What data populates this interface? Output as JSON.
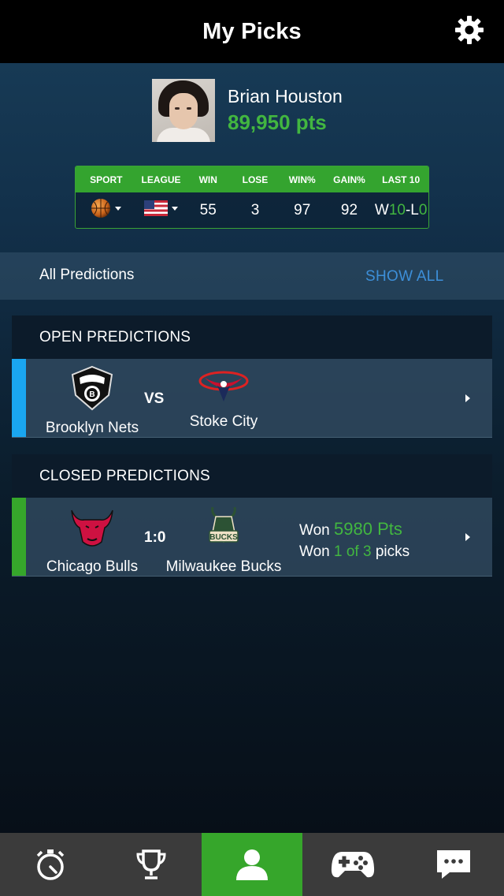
{
  "header": {
    "title": "My Picks",
    "settings_icon": "gear-icon"
  },
  "profile": {
    "name": "Brian Houston",
    "points": "89,950 pts"
  },
  "stats": {
    "headers": [
      "SPORT",
      "LEAGUE",
      "WIN",
      "LOSE",
      "WIN%",
      "GAIN%",
      "LAST 10"
    ],
    "sport_icon": "basketball-icon",
    "league_icon": "us-flag-icon",
    "win": "55",
    "lose": "3",
    "win_pct": "97",
    "gain_pct": "92",
    "last10": {
      "w_label": "W",
      "w_value": "10",
      "separator": "-L",
      "l_value": "0"
    }
  },
  "all_predictions": {
    "label": "All Predictions",
    "action": "SHOW ALL"
  },
  "open_predictions": {
    "title": "OPEN PREDICTIONS",
    "items": [
      {
        "home": "Brooklyn Nets",
        "away": "Stoke City",
        "separator": "VS",
        "accent": "#1aa6f0"
      }
    ]
  },
  "closed_predictions": {
    "title": "CLOSED PREDICTIONS",
    "items": [
      {
        "home": "Chicago Bulls",
        "away": "Milwaukee Bucks",
        "score": "1:0",
        "won_prefix": "Won",
        "won_points": "5980 Pts",
        "picks_prefix": "Won",
        "picks_value": "1 of 3",
        "picks_suffix": "picks",
        "accent": "#36a62b"
      }
    ]
  },
  "tabbar": {
    "items": [
      {
        "icon": "stopwatch-icon"
      },
      {
        "icon": "trophy-icon"
      },
      {
        "icon": "user-icon",
        "active": true
      },
      {
        "icon": "gamepad-icon"
      },
      {
        "icon": "chat-icon"
      }
    ]
  },
  "colors": {
    "accent_green": "#42b640",
    "link_blue": "#3d8fd9",
    "open_accent": "#1aa6f0",
    "closed_accent": "#36a62b"
  }
}
